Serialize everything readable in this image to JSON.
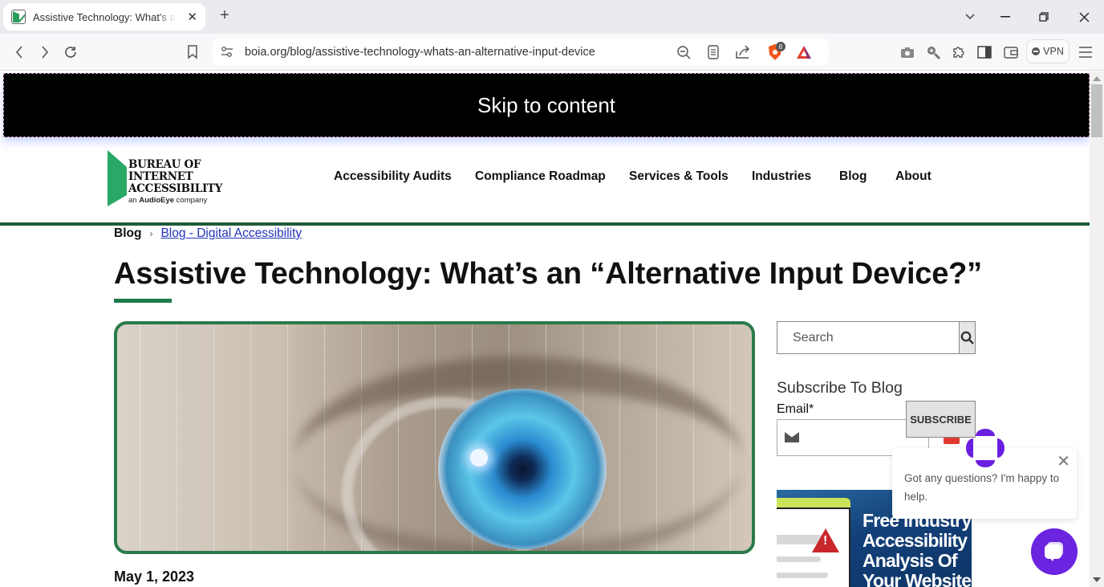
{
  "browser": {
    "tab_title": "Assistive Technology: What's an “Alternative Input Device?”",
    "url": "boia.org/blog/assistive-technology-whats-an-alternative-input-device",
    "brave_shield_count": "8",
    "vpn_label": "VPN"
  },
  "page": {
    "skip_link": "Skip to content",
    "logo": {
      "line1": "BUREAU OF",
      "line2": "INTERNET",
      "line3": "ACCESSIBILITY",
      "tag_prefix": "an",
      "tag_brand": "AudioEye",
      "tag_suffix": "company"
    },
    "nav": [
      {
        "label": "Accessibility Audits"
      },
      {
        "label": "Compliance Roadmap"
      },
      {
        "label": "Services & Tools"
      },
      {
        "label": "Industries"
      },
      {
        "label": "Blog"
      },
      {
        "label": "About"
      }
    ],
    "breadcrumb": {
      "root": "Blog",
      "separator": "›",
      "current": "Blog - Digital Accessibility"
    },
    "title": "Assistive Technology: What’s an “Alternative Input Device?”",
    "date": "May 1, 2023",
    "sidebar": {
      "search_placeholder": "Search",
      "subscribe_heading": "Subscribe To Blog",
      "email_label": "Email*",
      "email_value": "",
      "subscribe_button": "SUBSCRIBE",
      "ad_lines": [
        "Free Industry",
        "Accessibility",
        "Analysis Of",
        "Your Website"
      ]
    },
    "chat": {
      "message": "Got any questions? I'm happy to help."
    }
  },
  "colors": {
    "brand_green": "#2aa866",
    "dark_green": "#1f5a3a",
    "chat_purple": "#6b24e0",
    "link_blue": "#2233bb"
  }
}
